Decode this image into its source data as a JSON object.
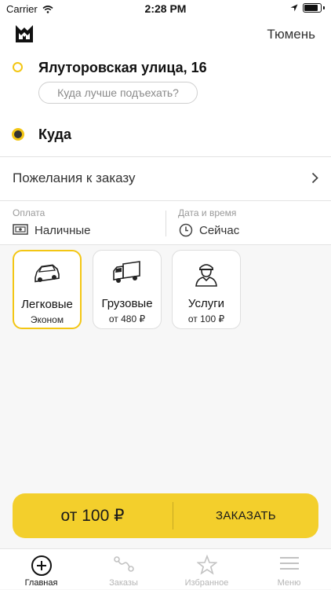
{
  "status_bar": {
    "carrier": "Carrier",
    "time": "2:28 PM"
  },
  "header": {
    "city": "Тюмень",
    "logo": "brand-logo-icon"
  },
  "route": {
    "from": "Ялуторовская улица, 16",
    "pickup_hint": "Куда лучше подъехать?",
    "to_placeholder": "Куда"
  },
  "wishes": {
    "label": "Пожелания к заказу"
  },
  "payment": {
    "label": "Оплата",
    "value": "Наличные"
  },
  "datetime": {
    "label": "Дата и время",
    "value": "Сейчас"
  },
  "tariffs": [
    {
      "title": "Легковые",
      "subtitle": "Эконом",
      "icon": "car-icon",
      "selected": true
    },
    {
      "title": "Грузовые",
      "subtitle": "от 480 ₽",
      "icon": "truck-icon",
      "selected": false
    },
    {
      "title": "Услуги",
      "subtitle": "от 100 ₽",
      "icon": "worker-icon",
      "selected": false
    }
  ],
  "order": {
    "price": "от 100 ₽",
    "button": "ЗАКАЗАТЬ"
  },
  "tabs": [
    {
      "label": "Главная",
      "icon": "plus-circle-icon",
      "active": true
    },
    {
      "label": "Заказы",
      "icon": "route-icon",
      "active": false
    },
    {
      "label": "Избранное",
      "icon": "star-icon",
      "active": false
    },
    {
      "label": "Меню",
      "icon": "menu-icon",
      "active": false
    }
  ],
  "colors": {
    "accent": "#f3c614",
    "order_bar": "#f3cf2c"
  }
}
